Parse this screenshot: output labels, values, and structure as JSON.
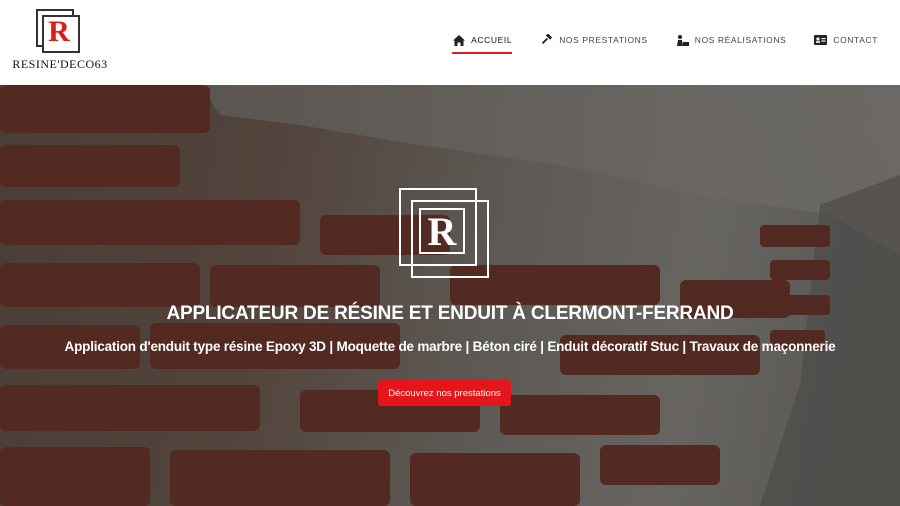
{
  "brand": {
    "logo_letter": "R",
    "name": "RESINE'DECO63",
    "accent": "#e01b1b"
  },
  "nav": {
    "items": [
      {
        "label": "ACCUEIL",
        "icon": "home-icon",
        "active": true
      },
      {
        "label": "NOS PRESTATIONS",
        "icon": "hammer-icon",
        "active": false
      },
      {
        "label": "NOS RÉALISATIONS",
        "icon": "worker-icon",
        "active": false
      },
      {
        "label": "CONTACT",
        "icon": "id-card-icon",
        "active": false
      }
    ]
  },
  "hero": {
    "logo_letter": "R",
    "title": "APPLICATEUR DE RÉSINE ET ENDUIT À CLERMONT-FERRAND",
    "subtitle": "Application d'enduit type résine Epoxy 3D | Moquette de marbre | Béton ciré | Enduit décoratif Stuc | Travaux de maçonnerie",
    "cta_label": "Découvrez nos prestations",
    "cta_color": "#e4161b"
  }
}
